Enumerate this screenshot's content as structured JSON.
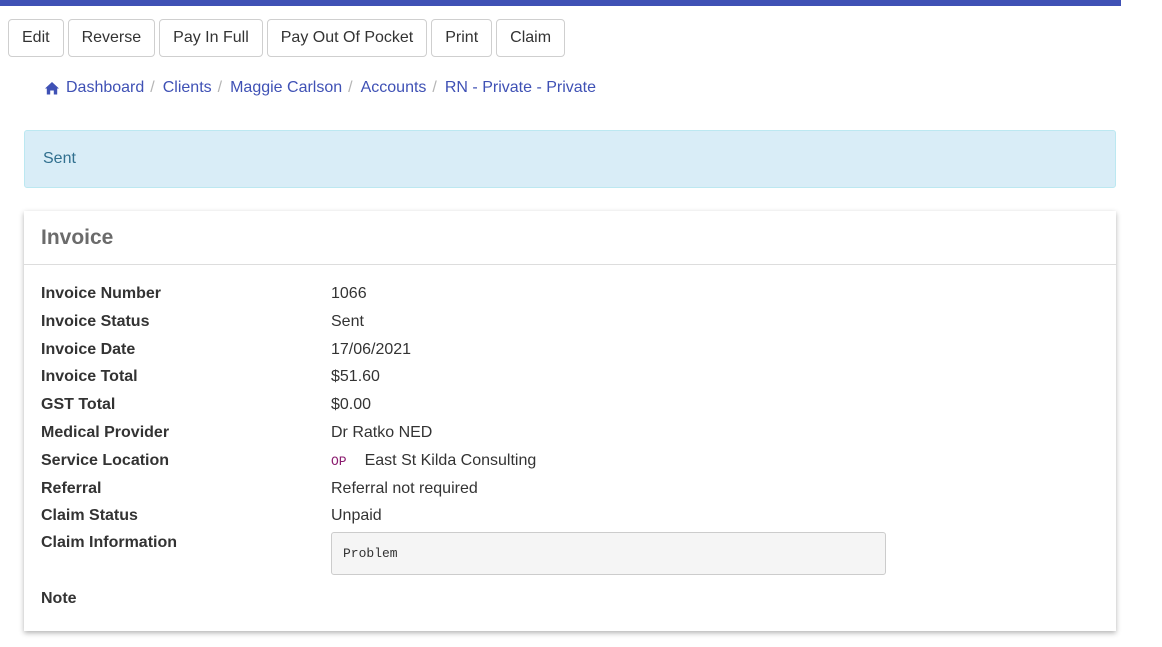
{
  "toolbar": {
    "buttons": [
      "Edit",
      "Reverse",
      "Pay In Full",
      "Pay Out Of Pocket",
      "Print",
      "Claim"
    ]
  },
  "breadcrumb": {
    "home_icon": "home-icon",
    "items": [
      "Dashboard",
      "Clients",
      "Maggie Carlson",
      "Accounts",
      "RN - Private - Private"
    ],
    "separator": "/"
  },
  "alert": {
    "text": "Sent"
  },
  "invoice": {
    "title": "Invoice",
    "fields": {
      "invoice_number": {
        "label": "Invoice Number",
        "value": "1066"
      },
      "invoice_status": {
        "label": "Invoice Status",
        "value": "Sent"
      },
      "invoice_date": {
        "label": "Invoice Date",
        "value": "17/06/2021"
      },
      "invoice_total": {
        "label": "Invoice Total",
        "value": "$51.60"
      },
      "gst_total": {
        "label": "GST Total",
        "value": "$0.00"
      },
      "medical_provider": {
        "label": "Medical Provider",
        "value": "Dr Ratko NED"
      },
      "service_location": {
        "label": "Service Location",
        "badge": "OP",
        "value": "East St Kilda Consulting"
      },
      "referral": {
        "label": "Referral",
        "value": "Referral not required"
      },
      "claim_status": {
        "label": "Claim Status",
        "value": "Unpaid"
      },
      "claim_information": {
        "label": "Claim Information",
        "value": "Problem"
      },
      "note": {
        "label": "Note",
        "value": ""
      }
    }
  },
  "colors": {
    "accent": "#3f51b5",
    "alert_bg": "#d9edf7",
    "alert_text": "#31708f",
    "badge": "#8a1a6e"
  }
}
